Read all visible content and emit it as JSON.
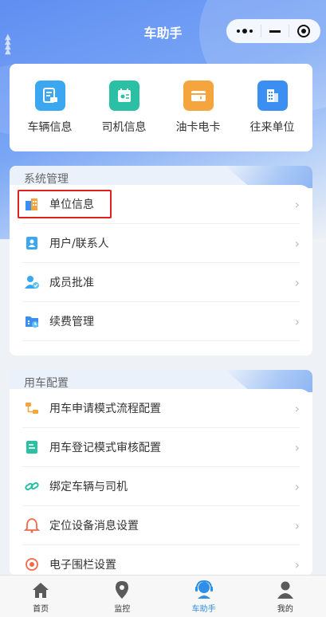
{
  "header": {
    "title": "车助手"
  },
  "quick_actions": [
    {
      "label": "车辆信息",
      "icon": "vehicle-doc-icon",
      "color": "#3aa7f0"
    },
    {
      "label": "司机信息",
      "icon": "driver-card-icon",
      "color": "#2bbfa4"
    },
    {
      "label": "油卡电卡",
      "icon": "fuel-card-icon",
      "color": "#f5a53d"
    },
    {
      "label": "往来单位",
      "icon": "building-icon",
      "color": "#3b8ff2"
    }
  ],
  "system_section": {
    "title": "系统管理",
    "items": [
      {
        "label": "单位信息",
        "icon": "organization-icon"
      },
      {
        "label": "用户/联系人",
        "icon": "contact-card-icon"
      },
      {
        "label": "成员批准",
        "icon": "member-approve-icon"
      },
      {
        "label": "续费管理",
        "icon": "renewal-folder-icon"
      }
    ]
  },
  "vehicle_section": {
    "title": "用车配置",
    "items": [
      {
        "label": "用车申请模式流程配置",
        "icon": "workflow-icon"
      },
      {
        "label": "用车登记模式审核配置",
        "icon": "register-audit-icon"
      },
      {
        "label": "绑定车辆与司机",
        "icon": "link-icon"
      },
      {
        "label": "定位设备消息设置",
        "icon": "bell-icon"
      },
      {
        "label": "电子围栏设置",
        "icon": "geofence-icon"
      }
    ]
  },
  "tabbar": [
    {
      "label": "首页",
      "icon": "home-icon",
      "active": false
    },
    {
      "label": "监控",
      "icon": "location-pin-icon",
      "active": false
    },
    {
      "label": "车助手",
      "icon": "assistant-icon",
      "active": true
    },
    {
      "label": "我的",
      "icon": "profile-icon",
      "active": false
    }
  ],
  "colors": {
    "accent": "#2f8fe6",
    "highlight_box": "#e02020"
  }
}
